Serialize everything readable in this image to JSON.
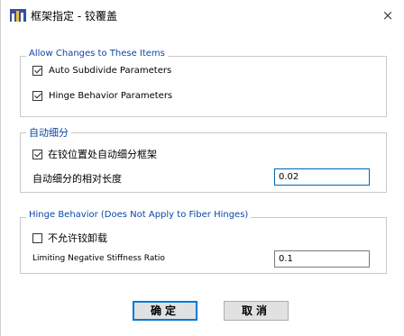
{
  "window": {
    "title": "框架指定 - 铰覆盖",
    "close_glyph": "×"
  },
  "allow_changes": {
    "legend": "Allow Changes to These Items",
    "auto_subdivide": {
      "label": "Auto Subdivide Parameters",
      "checked": true
    },
    "hinge_behavior": {
      "label": "Hinge Behavior Parameters",
      "checked": true
    }
  },
  "auto_subdivide": {
    "legend": "自动细分",
    "subdivide_at_hinge": {
      "label": "在铰位置处自动细分框架",
      "checked": true
    },
    "relative_length": {
      "label": "自动细分的相对长度",
      "value": "0.02"
    }
  },
  "hinge_behavior": {
    "legend": "Hinge Behavior  (Does Not Apply to Fiber Hinges)",
    "disallow_unloading": {
      "label": "不允许铰卸载",
      "checked": false
    },
    "neg_stiffness": {
      "label": "Limiting Negative Stiffness Ratio",
      "value": "0.1"
    }
  },
  "buttons": {
    "ok": "确定",
    "cancel": "取消"
  },
  "colors": {
    "legend": "#0b47a8",
    "focus_border": "#0063b1",
    "default_button_border": "#0078d7"
  }
}
